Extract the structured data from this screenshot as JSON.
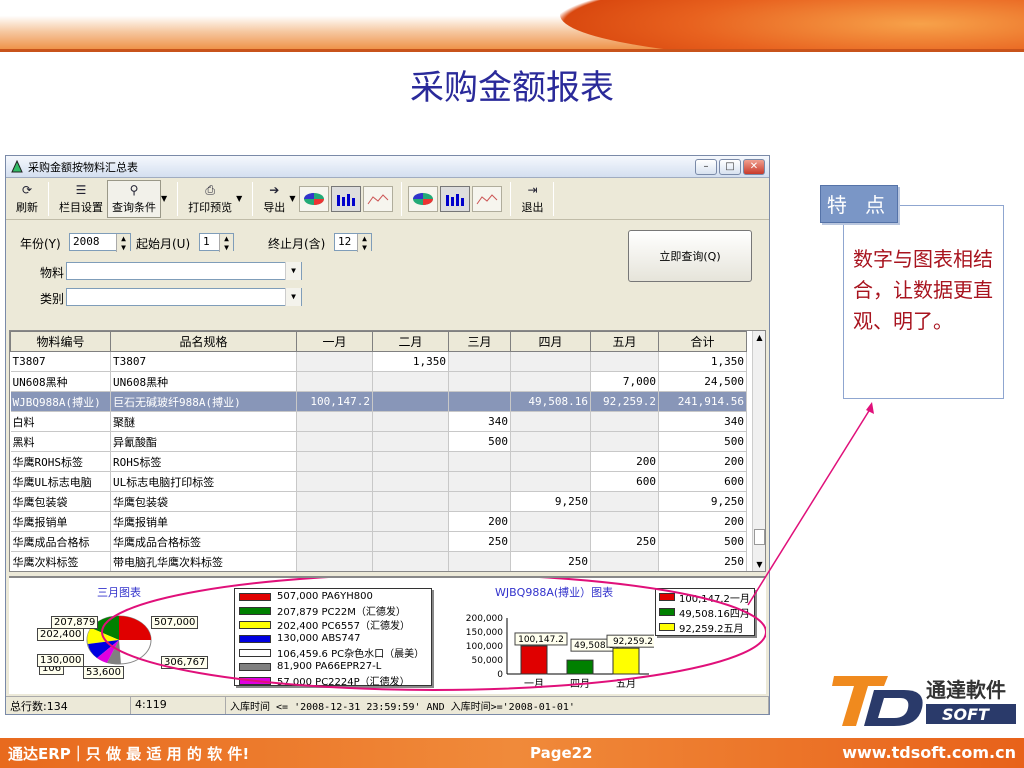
{
  "slide": {
    "title": "采购金额报表",
    "page": "Page22",
    "brand": "通达ERP｜只 做 最 适 用 的 软 件!",
    "url": "www.tdsoft.com.cn"
  },
  "feature": {
    "tab": "特 点",
    "text": "数字与图表相结合，让数据更直观、明了。"
  },
  "logo": {
    "cn": "通達軟件",
    "en": "SOFT"
  },
  "window": {
    "title": "采购金额按物料汇总表"
  },
  "toolbar": {
    "refresh": "刷新",
    "columns": "栏目设置",
    "query": "查询条件",
    "print": "打印预览",
    "export": "导出",
    "exit": "退出"
  },
  "filters": {
    "year_label": "年份(Y)",
    "year": "2008",
    "start_label": "起始月(U)",
    "start": "1",
    "end_label": "终止月(含)",
    "end": "12",
    "material_label": "物料",
    "category_label": "类别",
    "query_button": "立即查询(Q)"
  },
  "table": {
    "headers": [
      "物料编号",
      "品名规格",
      "一月",
      "二月",
      "三月",
      "四月",
      "五月",
      "合计"
    ],
    "rows": [
      [
        "T3807",
        "T3807",
        "",
        "1,350",
        "",
        "",
        "",
        "1,350"
      ],
      [
        "UN608黑种",
        "UN608黑种",
        "",
        "",
        "",
        "",
        "7,000",
        "24,500"
      ],
      [
        "WJBQ988A(搏业)",
        "巨石无碱玻纤988A(搏业)",
        "100,147.2",
        "",
        "",
        "49,508.16",
        "92,259.2",
        "241,914.56"
      ],
      [
        "白料",
        "聚醚",
        "",
        "",
        "340",
        "",
        "",
        "340"
      ],
      [
        "黑料",
        "异氰酸酯",
        "",
        "",
        "500",
        "",
        "",
        "500"
      ],
      [
        "华鹰ROHS标签",
        "ROHS标签",
        "",
        "",
        "",
        "",
        "200",
        "200"
      ],
      [
        "华鹰UL标志电脑",
        "UL标志电脑打印标签",
        "",
        "",
        "",
        "",
        "600",
        "600"
      ],
      [
        "华鹰包装袋",
        "华鹰包装袋",
        "",
        "",
        "",
        "9,250",
        "",
        "9,250"
      ],
      [
        "华鹰报销单",
        "华鹰报销单",
        "",
        "",
        "200",
        "",
        "",
        "200"
      ],
      [
        "华鹰成品合格标",
        "华鹰成品合格标签",
        "",
        "",
        "250",
        "",
        "250",
        "500"
      ],
      [
        "华鹰次料标签",
        "带电脑孔华鹰次料标签",
        "",
        "",
        "",
        "250",
        "",
        "250"
      ]
    ]
  },
  "pie": {
    "title": "三月图表",
    "labels": [
      "207,879",
      "202,400",
      "507,000",
      "106",
      "53,600",
      "306,767",
      "130,000"
    ]
  },
  "pie_legend": [
    {
      "color": "#e00000",
      "text": "507,000 PA6YH800"
    },
    {
      "color": "#008000",
      "text": "207,879 PC22M（汇德发）"
    },
    {
      "color": "#ffff00",
      "text": "202,400 PC6557（汇德发）"
    },
    {
      "color": "#0000e0",
      "text": "130,000 ABS747"
    },
    {
      "color": "#ffffff",
      "text": "106,459.6 PC杂色水口（晨美）"
    },
    {
      "color": "#808080",
      "text": "81,900 PA66EPR27-L"
    },
    {
      "color": "#e000e0",
      "text": "57,000 PC2224P（汇德发）"
    }
  ],
  "chart_data": {
    "type": "bar",
    "title": "WJBQ988A(搏业）图表",
    "categories": [
      "一月",
      "四月",
      "五月"
    ],
    "values": [
      100147.2,
      49508.16,
      92259.2
    ],
    "ylim": [
      0,
      200000
    ],
    "yticks": [
      "200,000",
      "150,000",
      "100,000",
      "50,000",
      "0"
    ],
    "labels": [
      "100,147.2",
      "49,508.16",
      "92,259.2"
    ],
    "colors": [
      "#e00000",
      "#008000",
      "#ffff00"
    ],
    "legend": [
      {
        "color": "#e00000",
        "text": "100,147.2一月"
      },
      {
        "color": "#008000",
        "text": "49,508.16四月"
      },
      {
        "color": "#ffff00",
        "text": "92,259.2五月"
      }
    ]
  },
  "status": {
    "count": "总行数:134",
    "pos": "4:119",
    "filter": "入库时间 <= '2008-12-31 23:59:59' AND 入库时间>='2008-01-01'"
  }
}
